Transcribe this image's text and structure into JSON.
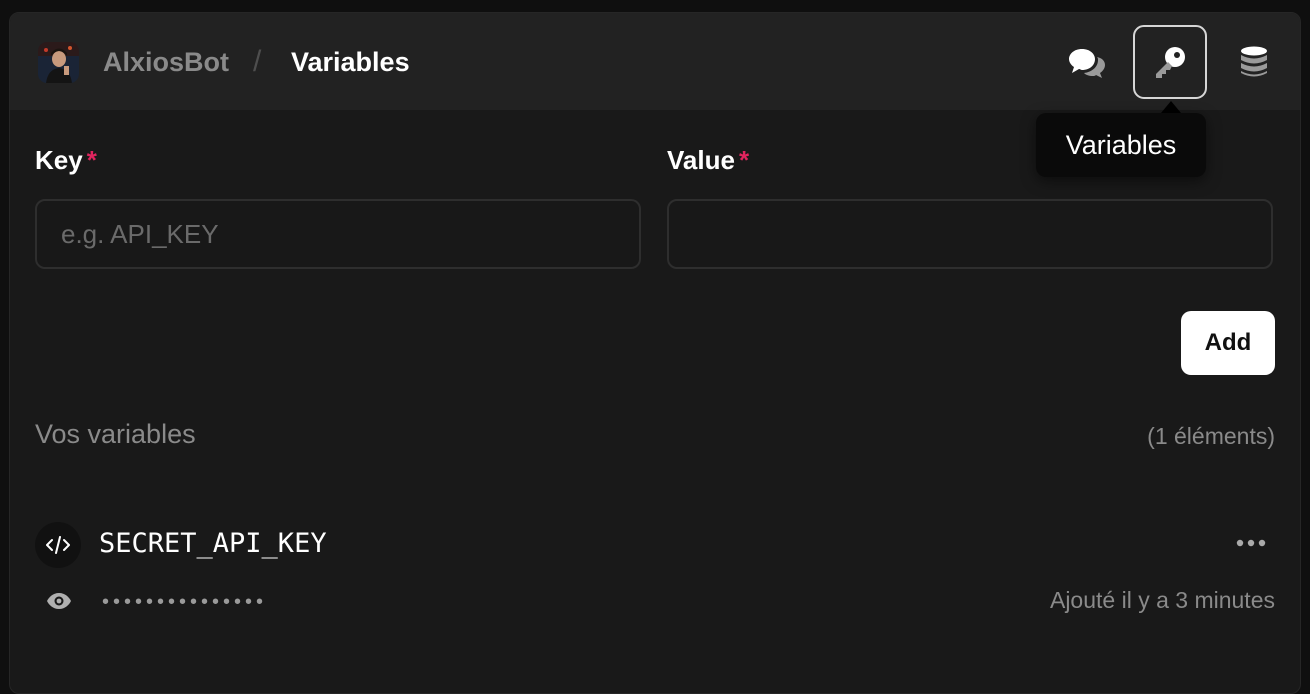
{
  "header": {
    "bot_name": "AlxiosBot",
    "separator": "/",
    "current_page": "Variables",
    "icons": [
      "chat-icon",
      "key-icon",
      "database-icon"
    ],
    "tooltip": "Variables"
  },
  "form": {
    "key_label": "Key",
    "value_label": "Value",
    "required_mark": "*",
    "key_placeholder": "e.g. API_KEY",
    "key_value": "",
    "value_value": "",
    "add_label": "Add"
  },
  "variables": {
    "title": "Vos variables",
    "count": "(1 éléments)",
    "items": [
      {
        "key": "SECRET_API_KEY",
        "masked_value": "•••••••••••••••",
        "added": "Ajouté il y a 3 minutes"
      }
    ]
  },
  "colors": {
    "background": "#0f0f0f",
    "panel": "#191919",
    "header": "#222222",
    "required": "#e0245e",
    "muted": "#8a8a8a"
  }
}
